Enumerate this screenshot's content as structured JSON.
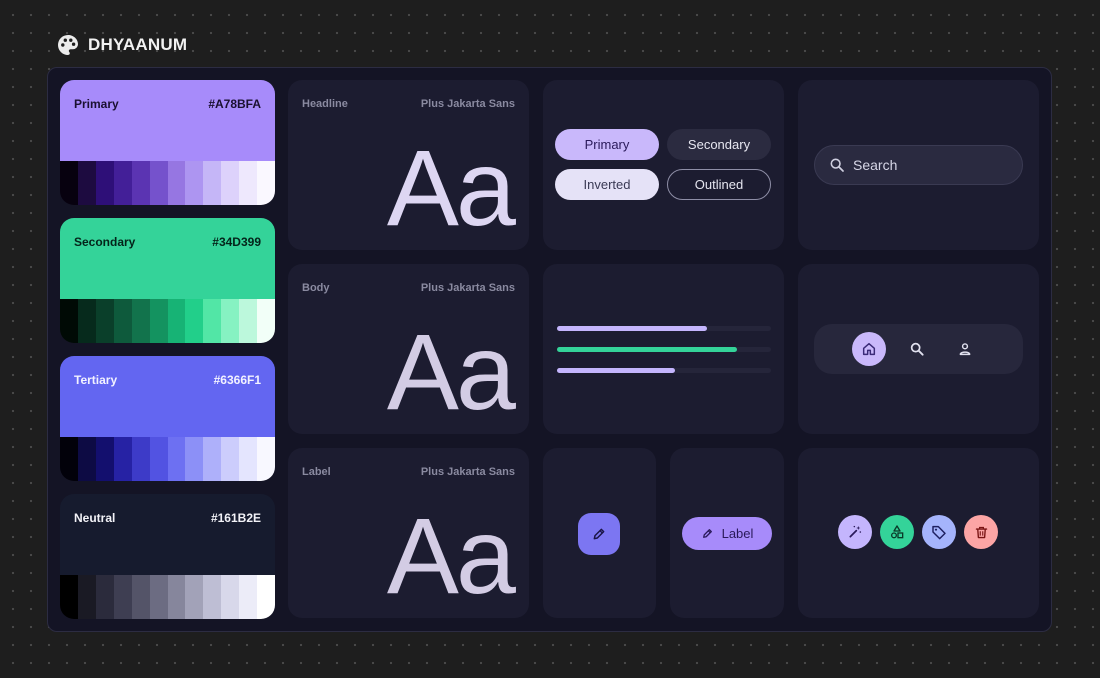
{
  "brand": {
    "name": "DHYAANUM",
    "icon": "palette-icon"
  },
  "colors": [
    {
      "label": "Primary",
      "hex": "#A78BFA",
      "base": "#a78bfa",
      "text": "#1a1030",
      "ramp": [
        "#07010f",
        "#1d0b40",
        "#2e0f78",
        "#431f98",
        "#5b34b2",
        "#7552cc",
        "#9676e2",
        "#ad95f1",
        "#c5b6f7",
        "#ddd2fb",
        "#eee8fd",
        "#faf8ff"
      ]
    },
    {
      "label": "Secondary",
      "hex": "#34D399",
      "base": "#34d399",
      "text": "#04241a",
      "ramp": [
        "#000a05",
        "#062a1c",
        "#0a3f2a",
        "#0e5a3c",
        "#12734c",
        "#149360",
        "#17b375",
        "#22cf8a",
        "#52e6a6",
        "#86f2c2",
        "#bcf8dc",
        "#f2fff8"
      ]
    },
    {
      "label": "Tertiary",
      "hex": "#6366F1",
      "base": "#6366f1",
      "text": "#f2f2ff",
      "ramp": [
        "#02010a",
        "#0d0b44",
        "#130f6e",
        "#2622a4",
        "#3d3bc8",
        "#5253e2",
        "#6d70f2",
        "#8c90f7",
        "#aeb0fa",
        "#cccdfc",
        "#e4e5fe",
        "#f8f8ff"
      ]
    },
    {
      "label": "Neutral",
      "hex": "#161B2E",
      "base": "#161b2e",
      "text": "#f2f2f7",
      "ramp": [
        "#000000",
        "#1a1a24",
        "#2b2b3c",
        "#3e3e52",
        "#545468",
        "#6c6c82",
        "#86869c",
        "#a2a2b8",
        "#bebed4",
        "#d8d8ea",
        "#ececf8",
        "#ffffff"
      ]
    }
  ],
  "typography": [
    {
      "role": "Headline",
      "font": "Plus Jakarta Sans",
      "sample": "Aa"
    },
    {
      "role": "Body",
      "font": "Plus Jakarta Sans",
      "sample": "Aa"
    },
    {
      "role": "Label",
      "font": "Plus Jakarta Sans",
      "sample": "Aa"
    }
  ],
  "buttons": {
    "primary": "Primary",
    "secondary": "Secondary",
    "inverted": "Inverted",
    "outlined": "Outlined"
  },
  "search": {
    "placeholder": "Search"
  },
  "progress": [
    {
      "value": 0.7,
      "color": "#c4b5fd"
    },
    {
      "value": 0.84,
      "color": "#34d399"
    },
    {
      "value": 0.55,
      "color": "#c4b5fd"
    }
  ],
  "nav": {
    "items": [
      {
        "icon": "home-icon"
      },
      {
        "icon": "search-icon"
      },
      {
        "icon": "person-icon"
      }
    ],
    "active": 0
  },
  "fab": {
    "icon": "pencil-icon"
  },
  "extended_fab": {
    "label": "Label",
    "icon": "pencil-icon"
  },
  "icon_buttons": [
    {
      "icon": "magic-wand-icon",
      "color": "#c4b5fd"
    },
    {
      "icon": "shapes-icon",
      "color": "#34d399"
    },
    {
      "icon": "tag-icon",
      "color": "#a5b4fc"
    },
    {
      "icon": "trash-icon",
      "color": "#fca5a5"
    }
  ]
}
